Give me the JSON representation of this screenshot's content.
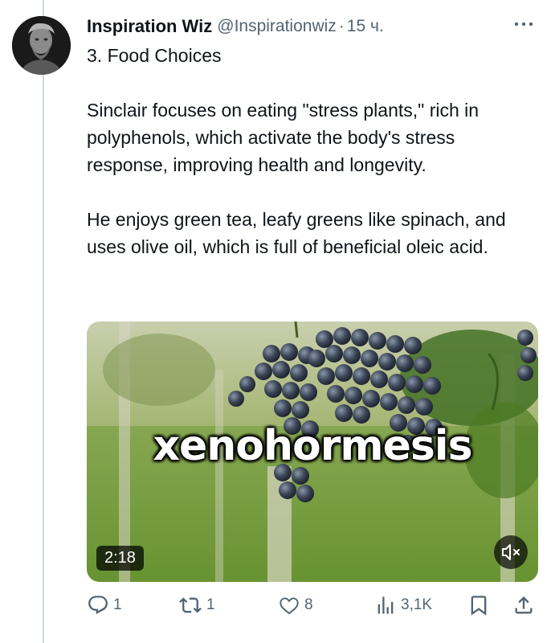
{
  "tweet": {
    "author_name": "Inspiration Wiz",
    "author_handle": "@Inspirationwiz",
    "separator": "·",
    "time": "15 ч.",
    "text_lines": [
      "3. Food Choices",
      "",
      "Sinclair focuses on eating \"stress plants,\" rich in polyphenols, which activate the body's stress response, improving health and longevity.",
      "",
      "He enjoys green tea, leafy greens like spinach, and uses olive oil, which is full of beneficial oleic acid."
    ]
  },
  "media": {
    "overlay_text": "xenohormesis",
    "duration": "2:18",
    "mute_icon": "speaker-muted-icon"
  },
  "actions": {
    "reply_count": "1",
    "retweet_count": "1",
    "like_count": "8",
    "views_count": "3,1K"
  },
  "icons": [
    "reply-icon",
    "retweet-icon",
    "like-icon",
    "views-icon",
    "bookmark-icon",
    "share-icon",
    "more-icon"
  ],
  "colors": {
    "text": "#0f1419",
    "secondary": "#536471",
    "thread_line": "#cfd9de"
  }
}
